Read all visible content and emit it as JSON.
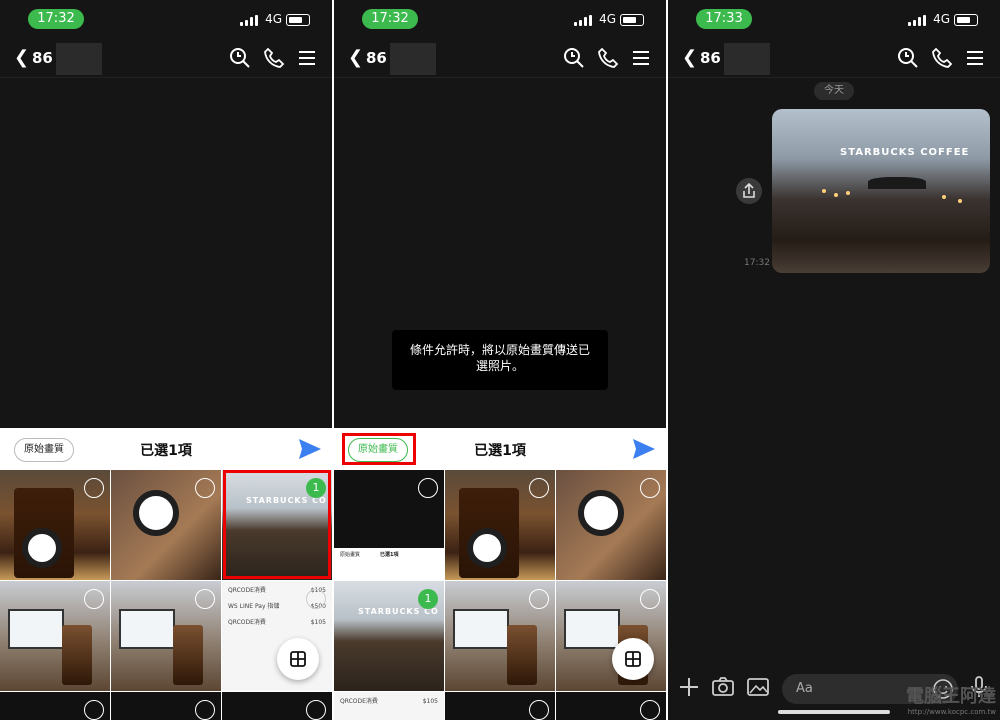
{
  "panels": [
    {
      "time": "17:32",
      "network": "4G",
      "back_number": "86"
    },
    {
      "time": "17:32",
      "network": "4G",
      "back_number": "86"
    },
    {
      "time": "17:33",
      "network": "4G",
      "back_number": "86"
    }
  ],
  "picker": {
    "hq_label": "原始畫質",
    "selected_label": "已選1項",
    "selected_badge": "1"
  },
  "toast": {
    "text": "條件允許時，將以原始畫質傳送已選照片。"
  },
  "chat": {
    "date_chip": "今天",
    "message_time": "17:32",
    "input_placeholder": "Aa",
    "photo_sign": "STARBUCKS COFFEE"
  },
  "receipt_rows": [
    {
      "label": "QRCODE消費",
      "amount": "$105"
    },
    {
      "label": "WS LINE Pay 指儲",
      "amount": "$500"
    },
    {
      "label": "QRCODE消費",
      "amount": "$105"
    }
  ],
  "mini_sheet": {
    "hq": "原始畫質",
    "sel": "已選1項"
  },
  "store_sign": "STARBUCKS CO",
  "watermark": {
    "title": "電腦王阿達",
    "url": "http://www.kocpc.com.tw"
  },
  "colors": {
    "line_green": "#3dba4e",
    "highlight_red": "#e00000",
    "send_blue": "#3b7ff0"
  }
}
